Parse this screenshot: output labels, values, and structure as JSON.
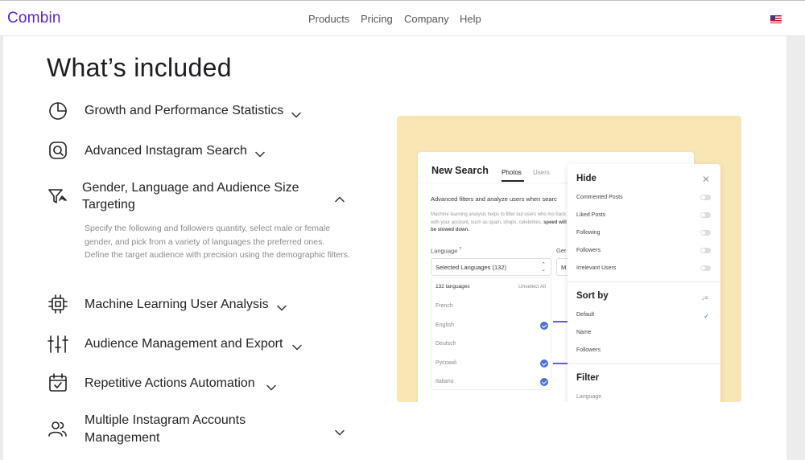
{
  "header": {
    "logo": "Combin",
    "nav": [
      "Products",
      "Pricing",
      "Company",
      "Help"
    ],
    "flag_icon": "us-flag-icon"
  },
  "main": {
    "title": "What’s included",
    "items": [
      {
        "label": "Growth and Performance Statistics",
        "icon": "pie-chart-icon",
        "expanded": false
      },
      {
        "label": "Advanced Instagram Search",
        "icon": "instagram-icon",
        "expanded": false
      },
      {
        "label_line1": "Gender, Language and Audience Size",
        "label_line2": "Targeting",
        "icon": "filter-icon",
        "expanded": true
      },
      {
        "label": "Machine Learning User Analysis",
        "icon": "chip-icon",
        "expanded": false
      },
      {
        "label": "Audience Management and Export",
        "icon": "sliders-icon",
        "expanded": false
      },
      {
        "label": "Repetitive Actions Automation",
        "icon": "calendar-check-icon",
        "expanded": false
      },
      {
        "label_line1": "Multiple Instagram Accounts",
        "label_line2": "Management",
        "icon": "users-icon",
        "expanded": false
      }
    ],
    "description": "Specify the following and followers quantity, select male or female gender, and pick from a variety of languages the preferred ones. Define the target audience with precision using the demographic filters."
  },
  "illustration": {
    "search_card": {
      "title": "New Search",
      "tabs": [
        "Photos",
        "Users"
      ],
      "subtitle": "Advanced filters and analyze users when searc",
      "ml_text": "Machine learning analysis helps to filter out users who mo back with your account, such as spam, shops, celebrities,",
      "ml_text_bold": "speed will be slowed down.",
      "language_label": "Language",
      "language_sup": "?",
      "gender_label": "Ger",
      "select_value": "Selected Languages (132)",
      "gender_value": "M",
      "dropdown": {
        "count": "132 languages",
        "unselect": "Unselect All",
        "languages": [
          {
            "name": "French",
            "checked": false
          },
          {
            "name": "English",
            "checked": true
          },
          {
            "name": "Deutsch",
            "checked": false
          },
          {
            "name": "Русский",
            "checked": true
          },
          {
            "name": "Italiano",
            "checked": true
          }
        ]
      }
    },
    "hide_card": {
      "hide_title": "Hide",
      "hide_items": [
        "Commented Posts",
        "Liked Posts",
        "Following",
        "Followers",
        "Irrelevant Users"
      ],
      "sort_title": "Sort by",
      "sort_items": [
        "Default",
        "Name",
        "Followers"
      ],
      "filter_title": "Filter",
      "filter_first": "Language"
    },
    "colors": {
      "background": "#f9e6b5",
      "accent": "#4a6fd6",
      "brand": "#5b21d6"
    }
  }
}
